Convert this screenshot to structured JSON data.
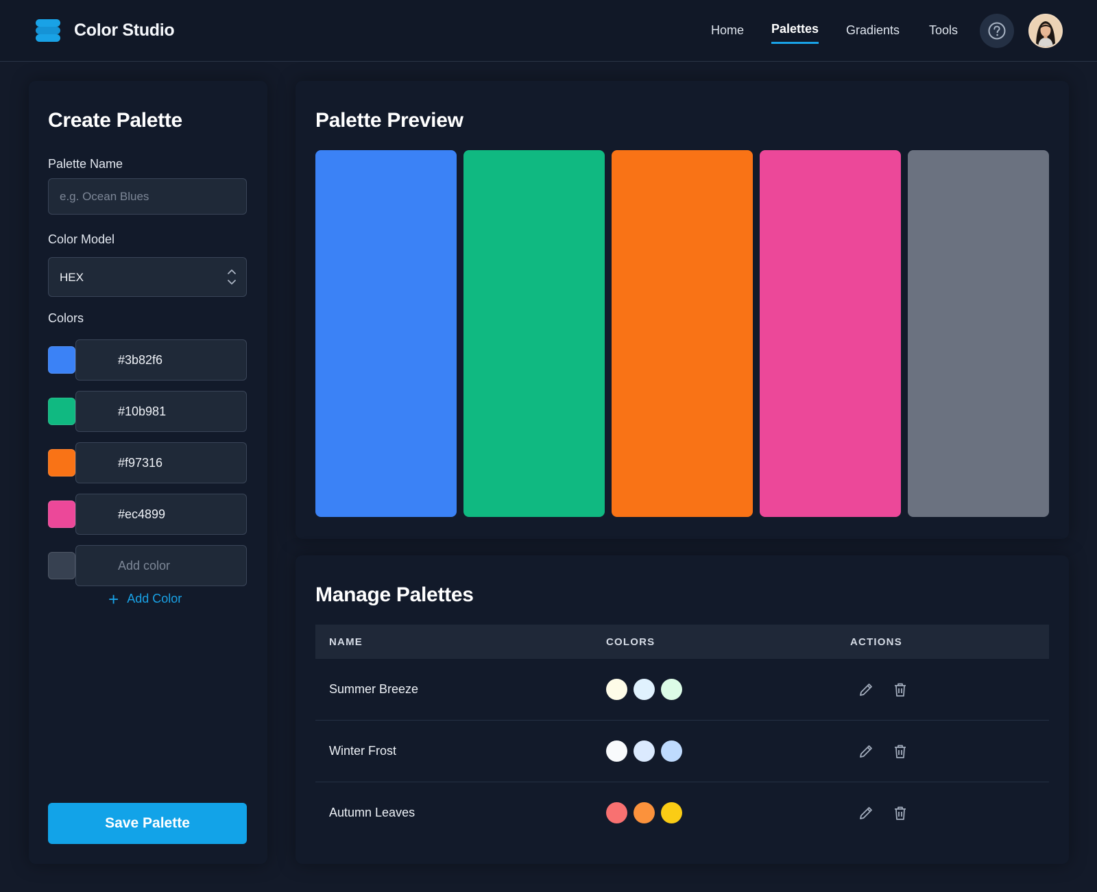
{
  "header": {
    "brand_title": "Color Studio",
    "nav": [
      {
        "label": "Home"
      },
      {
        "label": "Palettes",
        "active": true
      },
      {
        "label": "Gradients"
      },
      {
        "label": "Tools"
      }
    ],
    "icons": [
      "stack-logo-icon",
      "help-icon",
      "user-avatar"
    ]
  },
  "create": {
    "title": "Create Palette",
    "name_label": "Palette Name",
    "name_placeholder": "e.g. Ocean Blues",
    "name_value": "",
    "model_label": "Color Model",
    "model_value": "HEX",
    "colors_label": "Colors",
    "colors": [
      {
        "hex": "#3b82f6"
      },
      {
        "hex": "#10b981"
      },
      {
        "hex": "#f97316"
      },
      {
        "hex": "#ec4899"
      }
    ],
    "add_color_placeholder": "Add color",
    "empty_swatch_color": "#374151",
    "add_color_label": "Add Color",
    "save_label": "Save Palette"
  },
  "preview": {
    "title": "Palette Preview",
    "swatches": [
      "#3b82f6",
      "#10b981",
      "#f97316",
      "#ec4899",
      "#6b7280"
    ]
  },
  "manage": {
    "title": "Manage Palettes",
    "columns": [
      "NAME",
      "COLORS",
      "ACTIONS"
    ],
    "rows": [
      {
        "name": "Summer Breeze",
        "colors": [
          "#fefce8",
          "#e0f2fe",
          "#dcfce7"
        ]
      },
      {
        "name": "Winter Frost",
        "colors": [
          "#f8fafc",
          "#dbeafe",
          "#bfdbfe"
        ]
      },
      {
        "name": "Autumn Leaves",
        "colors": [
          "#f87171",
          "#fb923c",
          "#facc15"
        ]
      }
    ],
    "row_actions": [
      "edit-pencil-icon",
      "trash-icon"
    ]
  },
  "theme": {
    "accent": "#19a2e6",
    "background": "#131a29",
    "panel": "#121a2a",
    "input": "#1f2938"
  }
}
